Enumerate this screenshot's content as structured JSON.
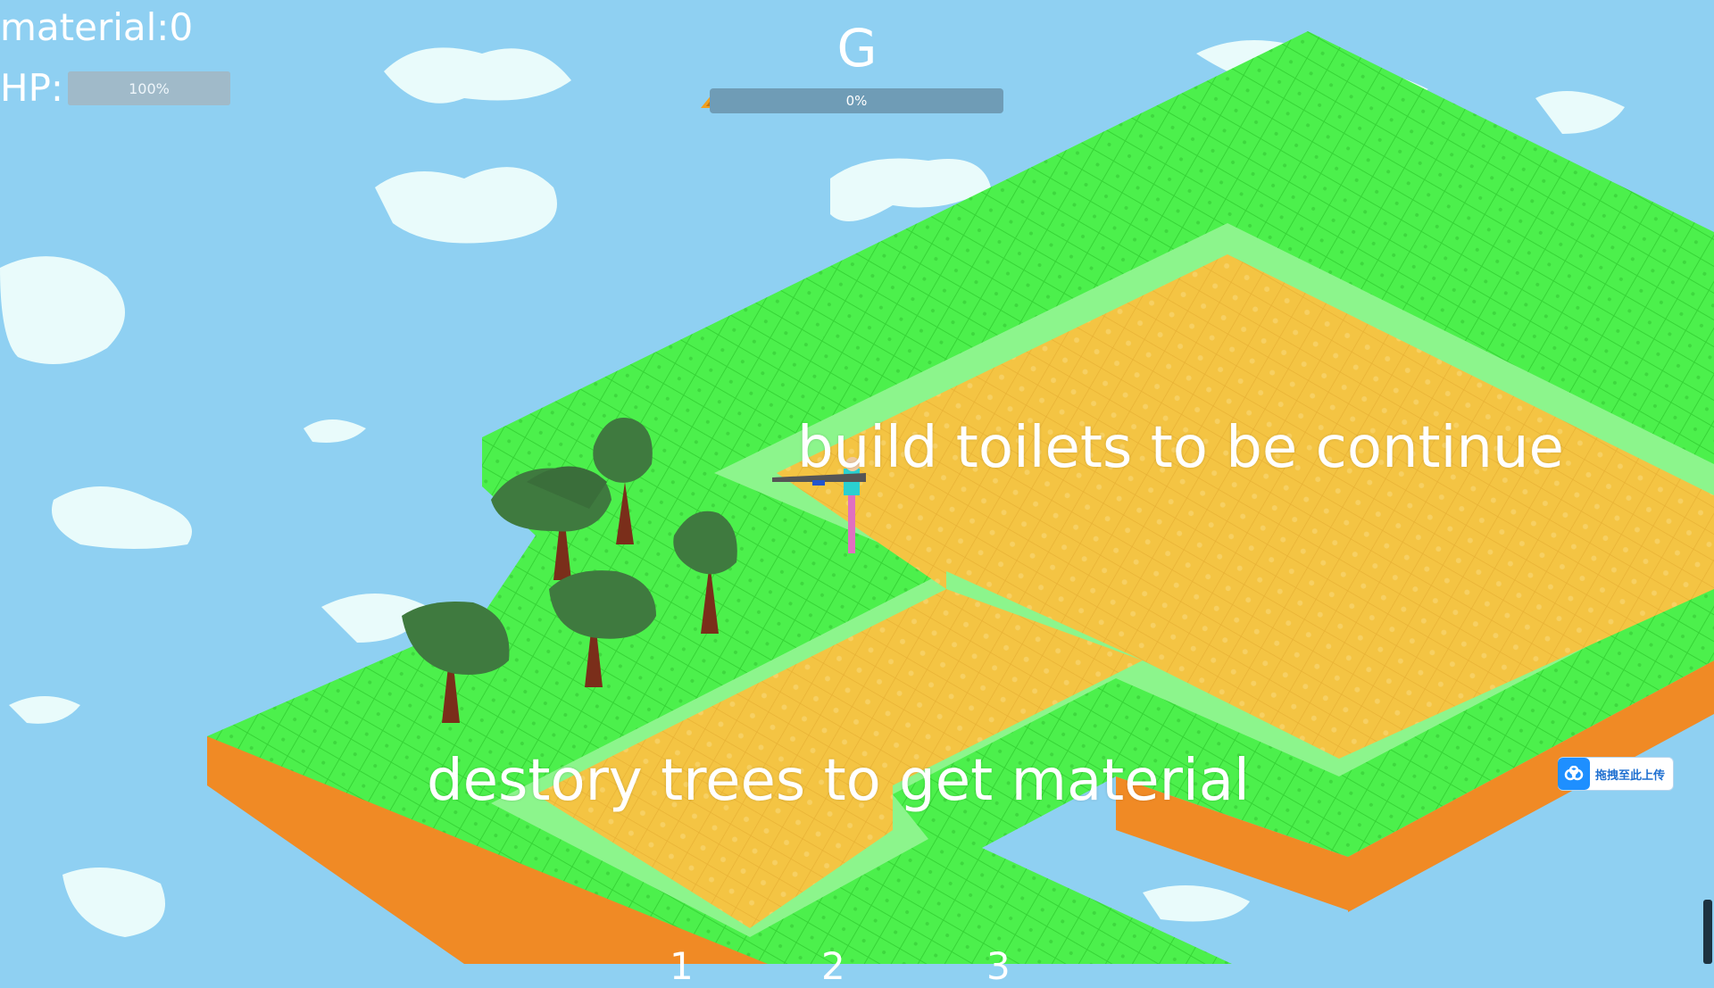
{
  "hud": {
    "material_label": "material:0",
    "hp_label": "HP:",
    "hp_percent_text": "100%",
    "hp_fraction": 1.0
  },
  "wave": {
    "letter": "G",
    "progress_text": "0%",
    "progress_fraction": 0.0
  },
  "hints": {
    "build": "build toilets to be continue",
    "destroy": "destory trees to get material"
  },
  "upload_widget": {
    "label": "拖拽至此上传",
    "icon": "cloud-upload-icon"
  },
  "hotbar": {
    "slots": [
      "1",
      "2",
      "3"
    ]
  },
  "colors": {
    "sky": "#8fd0f2",
    "cloud": "#e9fbfb",
    "grass": "#4cf04c",
    "grass_light": "#8cf58c",
    "dirt_side": "#f08a25",
    "sand": "#f4c443",
    "tree_foliage": "#3f7a3f",
    "tree_trunk": "#7a2e1a",
    "text": "#ffffff"
  }
}
